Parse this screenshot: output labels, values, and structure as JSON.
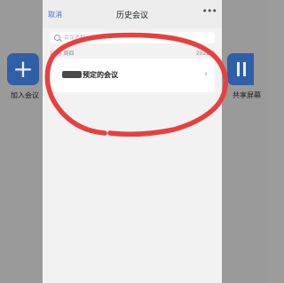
{
  "background": {
    "left_action_label": "加入会议",
    "right_action_label": "共享屏幕",
    "left_action_icon": "plus-icon",
    "right_action_icon": "share-screen-icon"
  },
  "sheet": {
    "cancel_label": "取消",
    "title": "历史会议",
    "more_icon": "more-horizontal-icon",
    "search_placeholder": "会议名称、会议号",
    "section_label": "12月 周四",
    "section_year": "2022年",
    "meeting": {
      "title_suffix": "预定的会议",
      "chevron_icon": "chevron-right-icon"
    }
  },
  "colors": {
    "accent": "#3b79d6",
    "annotation": "#e8403f",
    "tile": "#2f5fa6"
  }
}
